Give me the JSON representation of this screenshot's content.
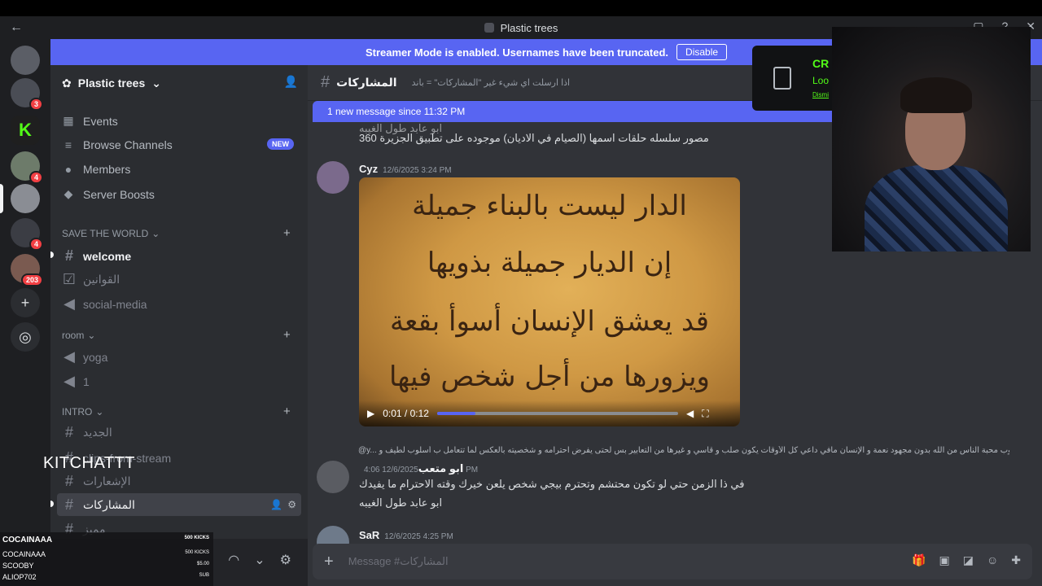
{
  "window": {
    "title": "Plastic trees",
    "back_icon": "arrow-left-icon"
  },
  "banner": {
    "text": "Streamer Mode is enabled. Usernames have been truncated.",
    "button": "Disable"
  },
  "rail": {
    "badges": [
      "3",
      "4",
      "4",
      "203"
    ]
  },
  "server": {
    "name": "Plastic trees"
  },
  "nav": [
    {
      "label": "Events",
      "icon": "calendar-icon"
    },
    {
      "label": "Browse Channels",
      "icon": "browse-icon",
      "badge": "NEW"
    },
    {
      "label": "Members",
      "icon": "members-icon"
    },
    {
      "label": "Server Boosts",
      "icon": "boost-icon"
    }
  ],
  "categories": {
    "save_the_world": "SAVE THE WORLD",
    "room": "room",
    "intro": "INTRO"
  },
  "channels": {
    "welcome": "welcome",
    "rules": "القوانين",
    "social": "social-media",
    "yoga": "yoga",
    "one": "1",
    "new": "الجديد",
    "clips": "clips-from-stream",
    "notifs": "الإشعارات",
    "participations": "المشاركات",
    "misc": "مميز"
  },
  "chat": {
    "channel": "المشاركات",
    "topic": "اذا ارسلت اي شيء غير \"المشاركات\" = باند",
    "new_messages": "1 new message since 11:32 PM",
    "prev_line1": "ابو عابد طول الغيبه",
    "prev_line2": "مصور سلسله حلقات اسمها (الصيام في الاديان) موجوده على تطبيق الجزيرة 360",
    "msg1_author": "Cyz",
    "msg1_time": "12/6/2025 3:24 PM",
    "video_time": "0:01 / 0:12",
    "video_progress": 0.16,
    "video_lines": [
      "الدار ليست بالبناء جميلة",
      "إن الديار جميلة بذويها",
      "قد يعشق الإنسان أسوأ بقعة",
      "ويزورها من أجل شخص فيها"
    ],
    "reply_preview": "@y... محبوب  محبة الناس من الله بدون مجهود نعمة  و  الإنسان مافي داعي كل  الأوقات يكون صلب و قاسي و غيرها من التعابير بس لحتى يفرض احترامه و شخصيته  بالعكس لما تتعامل ب أسلوب لطيف و...",
    "msg2_author": "ابو متعب",
    "msg2_time": "12/6/2025 4:06 PM",
    "msg2_line1": "في ذا الزمن حتي لو تكون محتشم وتحترم بيجي شخص يلعن خيرك وقته الاحترام ما يفيدك",
    "msg2_line2": "ابو عابد طول الغيبه",
    "msg3_author": "SaR",
    "msg3_time": "12/6/2025 4:25 PM",
    "composer_placeholder": "Message #المشاركات"
  },
  "overlay": {
    "popup_title": "CR",
    "popup_sub": "Loo",
    "popup_dismiss": "Dismi",
    "kitchat": "KITCHATTT",
    "donations": [
      {
        "name": "COCAINAAA",
        "amount": "500 KICKS"
      },
      {
        "name": "COCAINAAA",
        "amount": "500 KICKS"
      },
      {
        "name": "SCOOBY",
        "amount": "$5.00"
      },
      {
        "name": "ALIOP702",
        "amount": "SUB"
      }
    ]
  },
  "colors": {
    "blurple": "#5865f2",
    "kick_green": "#53fc18",
    "danger": "#f23f43"
  }
}
